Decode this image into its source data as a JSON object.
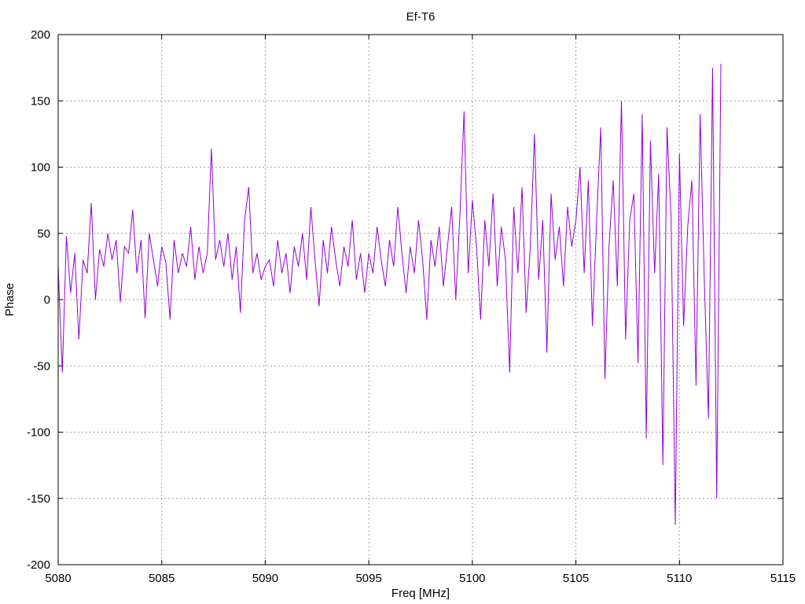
{
  "chart_data": {
    "type": "line",
    "title": "Ef-T6",
    "xlabel": "Freq [MHz]",
    "ylabel": "Phase",
    "xlim": [
      5080,
      5115
    ],
    "ylim": [
      -200,
      200
    ],
    "xticks": [
      5080,
      5085,
      5090,
      5095,
      5100,
      5105,
      5110,
      5115
    ],
    "yticks": [
      -200,
      -150,
      -100,
      -50,
      0,
      50,
      100,
      150,
      200
    ],
    "grid": true,
    "line_color": "#9400d3",
    "series": [
      {
        "name": "Phase",
        "x_start": 5080.0,
        "x_step": 0.2,
        "values": [
          25,
          -55,
          48,
          5,
          35,
          -30,
          30,
          20,
          73,
          0,
          38,
          25,
          50,
          30,
          45,
          -2,
          40,
          35,
          68,
          20,
          45,
          -14,
          50,
          30,
          10,
          40,
          28,
          -15,
          45,
          20,
          35,
          25,
          55,
          15,
          40,
          20,
          35,
          114,
          30,
          45,
          25,
          50,
          15,
          40,
          -10,
          60,
          85,
          20,
          35,
          15,
          25,
          30,
          10,
          45,
          20,
          35,
          5,
          40,
          25,
          50,
          15,
          70,
          30,
          -5,
          45,
          20,
          55,
          30,
          10,
          40,
          25,
          60,
          15,
          35,
          5,
          35,
          20,
          55,
          30,
          10,
          45,
          25,
          70,
          35,
          5,
          40,
          20,
          60,
          30,
          -15,
          45,
          25,
          55,
          10,
          40,
          70,
          0,
          65,
          142,
          20,
          75,
          40,
          -15,
          60,
          25,
          80,
          10,
          55,
          30,
          -55,
          70,
          20,
          85,
          -10,
          40,
          125,
          15,
          60,
          -40,
          80,
          30,
          55,
          10,
          70,
          40,
          60,
          100,
          20,
          90,
          -20,
          60,
          130,
          -60,
          40,
          90,
          10,
          150,
          -30,
          60,
          80,
          -48,
          140,
          -105,
          120,
          20,
          95,
          -125,
          130,
          60,
          -170,
          110,
          -20,
          55,
          90,
          -65,
          140,
          15,
          -90,
          175,
          -150,
          178
        ]
      }
    ]
  }
}
